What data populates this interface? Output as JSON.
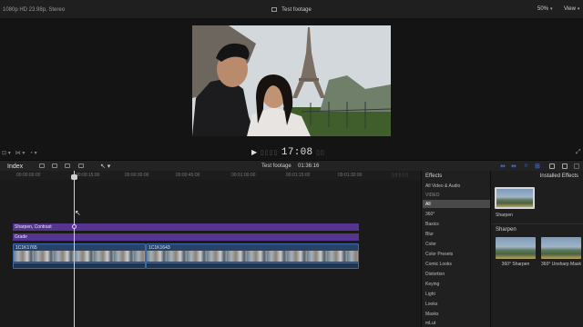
{
  "viewer": {
    "format": "1080p HD 23.98p, Stereo",
    "title": "Test footage",
    "zoom": "50%",
    "view_label": "View",
    "timecode": "17:08",
    "video_icon": "eiffel-tower-selfie-frame"
  },
  "timeline_toolbar": {
    "index_label": "Index",
    "project": "Test footage",
    "duration": "01:36:16"
  },
  "ruler_labels": [
    "00:00:00:00",
    "00:00:15:00",
    "00:00:30:00",
    "00:00:45:00",
    "00:01:00:00",
    "00:01:15:00",
    "00:01:30:00"
  ],
  "timeline": {
    "adjustment_bar_1": "Sharpen, Contrast",
    "adjustment_bar_2": "Grade",
    "clips": [
      {
        "name": "1C1K1765"
      },
      {
        "name": "1C1K1643"
      }
    ]
  },
  "effects": {
    "panel_title": "Effects",
    "installed_title": "Installed Effects",
    "categories": [
      "All Video & Audio",
      "VIDEO",
      "All",
      "360°",
      "Basics",
      "Blur",
      "Color",
      "Color Presets",
      "Comic Looks",
      "Distortion",
      "Keying",
      "Light",
      "Looks",
      "Masks",
      "mLut"
    ],
    "selected_category": "All",
    "top_effect": "Sharpen",
    "section": "Sharpen",
    "section_effects": [
      "360° Sharpen",
      "360° Unsharp Mask"
    ]
  }
}
